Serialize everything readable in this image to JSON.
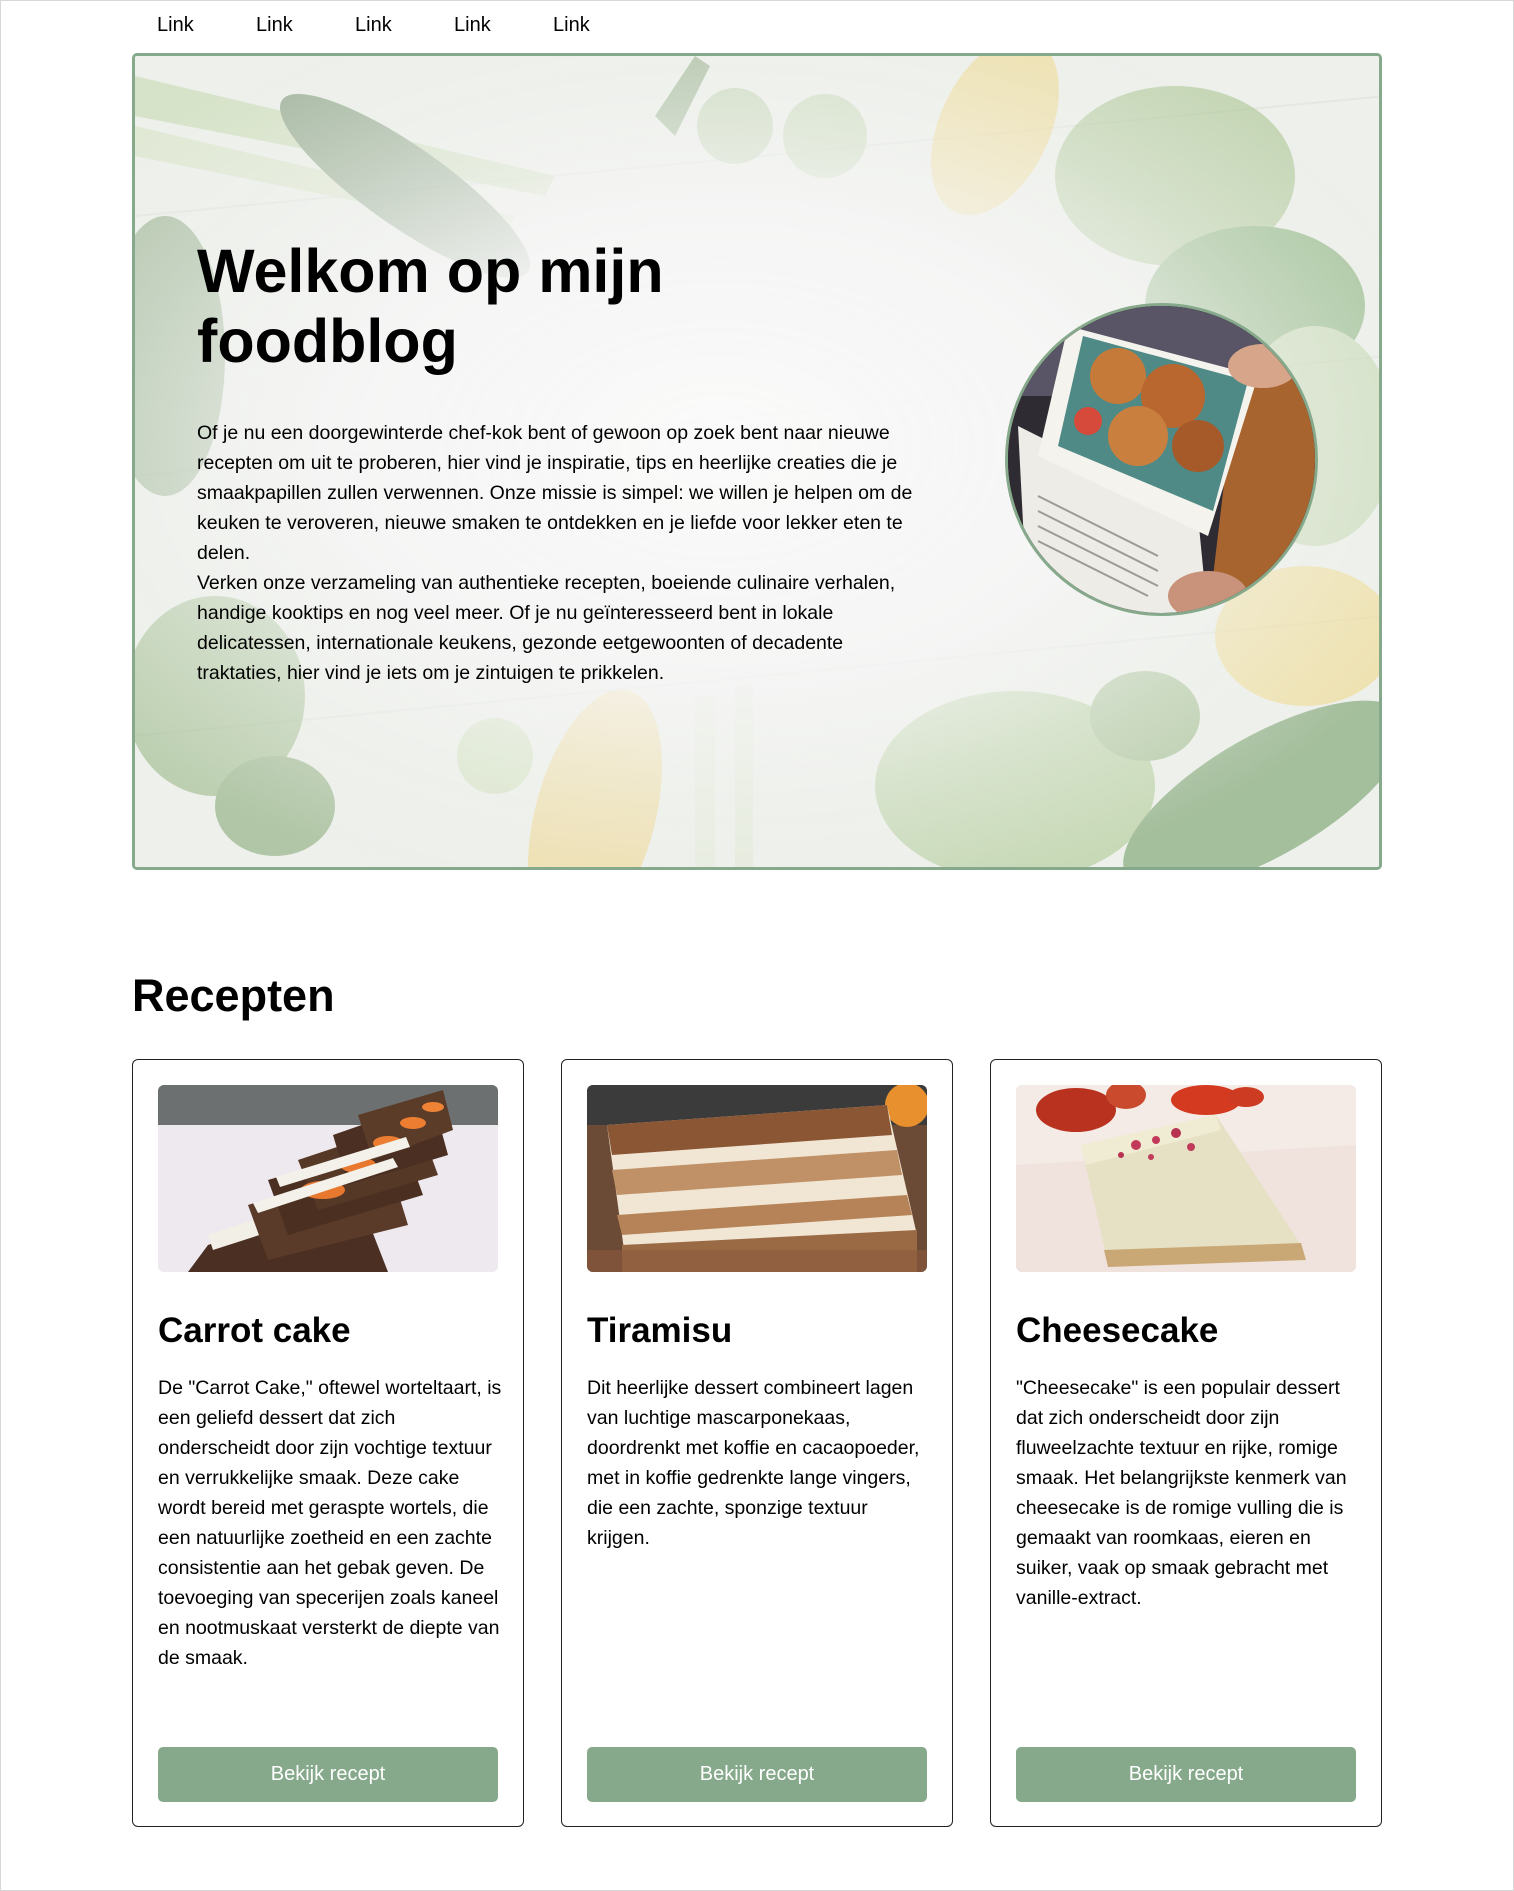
{
  "nav": {
    "links": [
      "Link",
      "Link",
      "Link",
      "Link",
      "Link"
    ]
  },
  "hero": {
    "title": "Welkom op mijn foodblog",
    "paragraphs": [
      "Of je nu een doorgewinterde chef-kok bent of gewoon op zoek bent naar nieuwe recepten om uit te proberen, hier vind je inspiratie, tips en heerlijke creaties die je smaakpapillen zullen verwennen. Onze missie is simpel: we willen je helpen om de keuken te veroveren, nieuwe smaken te ontdekken en je liefde voor lekker eten te delen.",
      "Verken onze verzameling van authentieke recepten, boeiende culinaire verhalen, handige kooktips en nog veel meer. Of je nu geïnteresseerd bent in lokale delicatessen, internationale keukens, gezonde eetgewoonten of decadente traktaties, hier vind je iets om je zintuigen te prikkelen."
    ]
  },
  "recipes": {
    "title": "Recepten",
    "cards": [
      {
        "title": "Carrot cake",
        "text": "De \"Carrot Cake,\" oftewel worteltaart, is een geliefd dessert dat zich onderscheidt door zijn vochtige textuur en verrukkelijke smaak. Deze cake wordt bereid met geraspte wortels, die een natuurlijke zoetheid en een zachte consistentie aan het gebak geven. De toevoeging van specerijen zoals kaneel en nootmuskaat versterkt de diepte van de smaak.",
        "button": "Bekijk recept"
      },
      {
        "title": "Tiramisu",
        "text": "Dit heerlijke dessert combineert lagen van luchtige mascarponekaas, doordrenkt met koffie en cacaopoeder, met in koffie gedrenkte lange vingers, die een zachte, sponzige textuur krijgen.",
        "button": "Bekijk recept"
      },
      {
        "title": "Cheesecake",
        "text": "\"Cheesecake\" is een populair dessert dat zich onderscheidt door zijn fluweelzachte textuur en rijke, romige smaak. Het belangrijkste kenmerk van cheesecake is de romige vulling die is gemaakt van roomkaas, eieren en suiker, vaak op smaak gebracht met vanille-extract.",
        "button": "Bekijk recept"
      }
    ]
  },
  "colors": {
    "accent": "#86a98b",
    "border": "#222222"
  }
}
